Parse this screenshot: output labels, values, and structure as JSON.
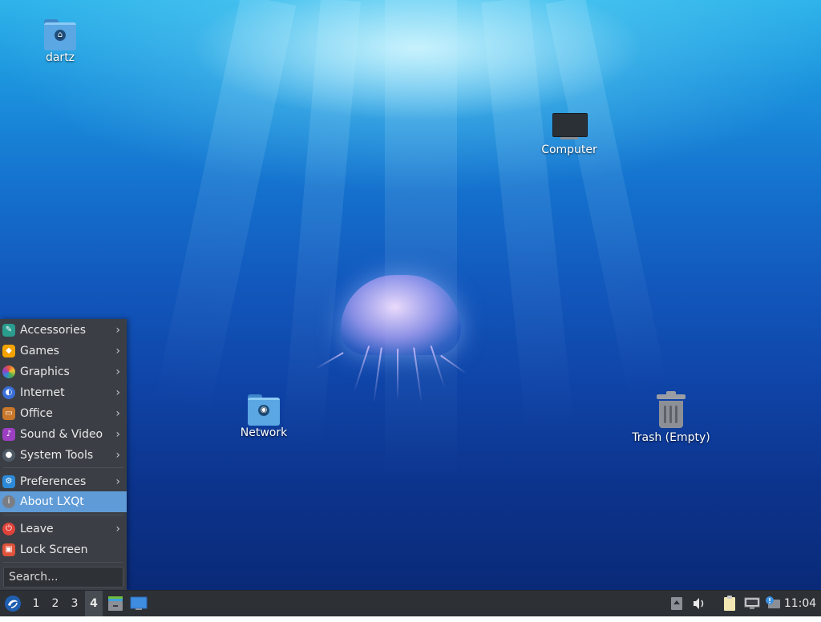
{
  "desktop": {
    "icons": {
      "home": {
        "label": "dartz",
        "icon": "home-folder-icon"
      },
      "computer": {
        "label": "Computer",
        "icon": "computer-icon"
      },
      "network": {
        "label": "Network",
        "icon": "network-folder-icon"
      },
      "trash": {
        "label": "Trash (Empty)",
        "icon": "trash-icon"
      }
    }
  },
  "menu": {
    "items": [
      {
        "label": "Accessories",
        "icon": "accessories-icon",
        "color": "#2a9d8f",
        "submenu": true
      },
      {
        "label": "Games",
        "icon": "games-icon",
        "color": "#f4a300",
        "submenu": true
      },
      {
        "label": "Graphics",
        "icon": "graphics-icon",
        "color": "#e8553a",
        "submenu": true
      },
      {
        "label": "Internet",
        "icon": "internet-icon",
        "color": "#3b6fd8",
        "submenu": true
      },
      {
        "label": "Office",
        "icon": "office-icon",
        "color": "#c9772b",
        "submenu": true
      },
      {
        "label": "Sound & Video",
        "icon": "sound-video-icon",
        "color": "#9c3fc2",
        "submenu": true
      },
      {
        "label": "System Tools",
        "icon": "system-tools-icon",
        "color": "#4f5a66",
        "submenu": true
      }
    ],
    "preferences": {
      "label": "Preferences",
      "icon": "preferences-icon",
      "color": "#2d8ad8"
    },
    "about": {
      "label": "About LXQt",
      "icon": "info-icon",
      "color": "#7a7e84"
    },
    "leave": {
      "label": "Leave",
      "icon": "power-icon",
      "color": "#e0433a"
    },
    "lock": {
      "label": "Lock Screen",
      "icon": "lock-icon",
      "color": "#e0533a"
    },
    "search": {
      "placeholder": "Search..."
    },
    "submenu_arrow": "›"
  },
  "taskbar": {
    "start_icon": "lxqt-start-icon",
    "desktops": [
      "1",
      "2",
      "3",
      "4"
    ],
    "active_desktop": "4",
    "launchers": [
      "file-manager-icon",
      "show-desktop-icon"
    ],
    "tray": [
      "volume-icon",
      "clipboard-icon",
      "network-icon",
      "update-notifier-icon"
    ],
    "clock": "11:04"
  },
  "colors": {
    "accent": "#5f9bd6",
    "panel": "#2d3035",
    "menu_bg": "#3b3f45"
  }
}
